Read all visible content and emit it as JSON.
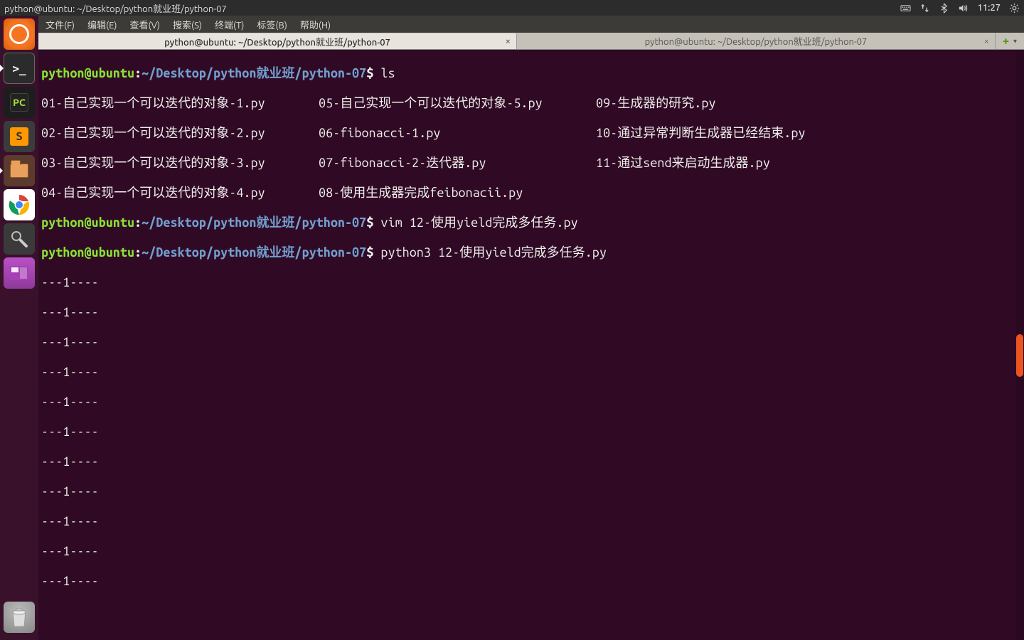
{
  "top_panel": {
    "title": "python@ubuntu: ~/Desktop/python就业班/python-07",
    "clock": "11:27"
  },
  "menu": {
    "file": "文件(F)",
    "edit": "编辑(E)",
    "view": "查看(V)",
    "search": "搜索(S)",
    "terminal": "终端(T)",
    "tabs": "标签(B)",
    "help": "帮助(H)"
  },
  "tabs": {
    "tab1": "python@ubuntu: ~/Desktop/python就业班/python-07",
    "tab2": "python@ubuntu: ~/Desktop/python就业班/python-07"
  },
  "prompt": {
    "userhost": "python@ubuntu",
    "colon": ":",
    "path_ascii": "~/Desktop/python",
    "path_cjk": "就业班",
    "path_tail": "/python-07",
    "dollar": "$"
  },
  "cmds": {
    "ls": " ls",
    "vim": " vim 12-使用yield完成多任务.py",
    "run": " python3 12-使用yield完成多任务.py"
  },
  "ls_output": {
    "r1c1": "01-自己实现一个可以迭代的对象-1.py",
    "r1c2": "05-自己实现一个可以迭代的对象-5.py",
    "r1c3": "09-生成器的研究.py",
    "r2c1": "02-自己实现一个可以迭代的对象-2.py",
    "r2c2": "06-fibonacci-1.py",
    "r2c3": "10-通过异常判断生成器已经结束.py",
    "r3c1": "03-自己实现一个可以迭代的对象-3.py",
    "r3c2": "07-fibonacci-2-迭代器.py",
    "r3c3": "11-通过send来启动生成器.py",
    "r4c1": "04-自己实现一个可以迭代的对象-4.py",
    "r4c2": "08-使用生成器完成feibonacii.py",
    "r4c3": ""
  },
  "program_output": {
    "line": "---1----"
  },
  "launcher": {
    "pycharm": "PC",
    "sublime": "S",
    "terminal": ">_"
  },
  "tab_actions": {
    "plus": "+",
    "down": "▾"
  },
  "close_glyph": "×"
}
